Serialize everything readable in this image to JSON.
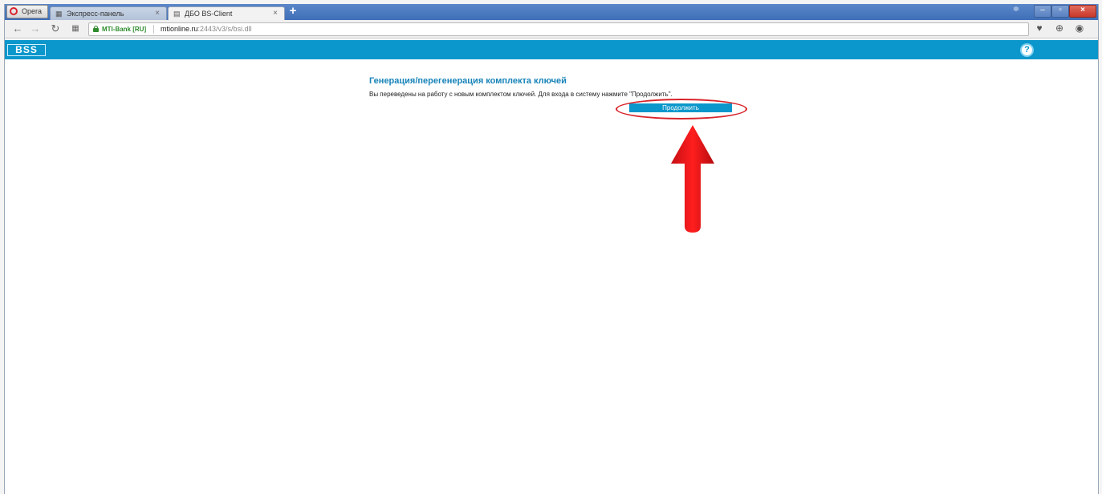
{
  "browser": {
    "menu_label": "Opera",
    "tabs": [
      {
        "label": "Экспресс-панель",
        "icon": "speed-dial-icon",
        "active": false
      },
      {
        "label": "ДБО BS-Client",
        "icon": "page-icon",
        "active": true
      }
    ],
    "new_tab_glyph": "+",
    "close_tab_glyph": "×",
    "address": {
      "certificate_label": "MTI-Bank [RU]",
      "host": "mtionline.ru",
      "path": ":2443/v3/s/bsi.dll"
    }
  },
  "app": {
    "logo_text": "BSS",
    "help_glyph": "?",
    "accent_color": "#0b97cb"
  },
  "main": {
    "title": "Генерация/перегенерация комплекта ключей",
    "message": "Вы переведены на работу с новым комплектом ключей. Для входа в систему нажмите \"Продолжить\".",
    "continue_label": "Продолжить"
  },
  "annotation": {
    "color": "#d8232a",
    "shapes": [
      "ellipse",
      "arrow-up"
    ]
  }
}
